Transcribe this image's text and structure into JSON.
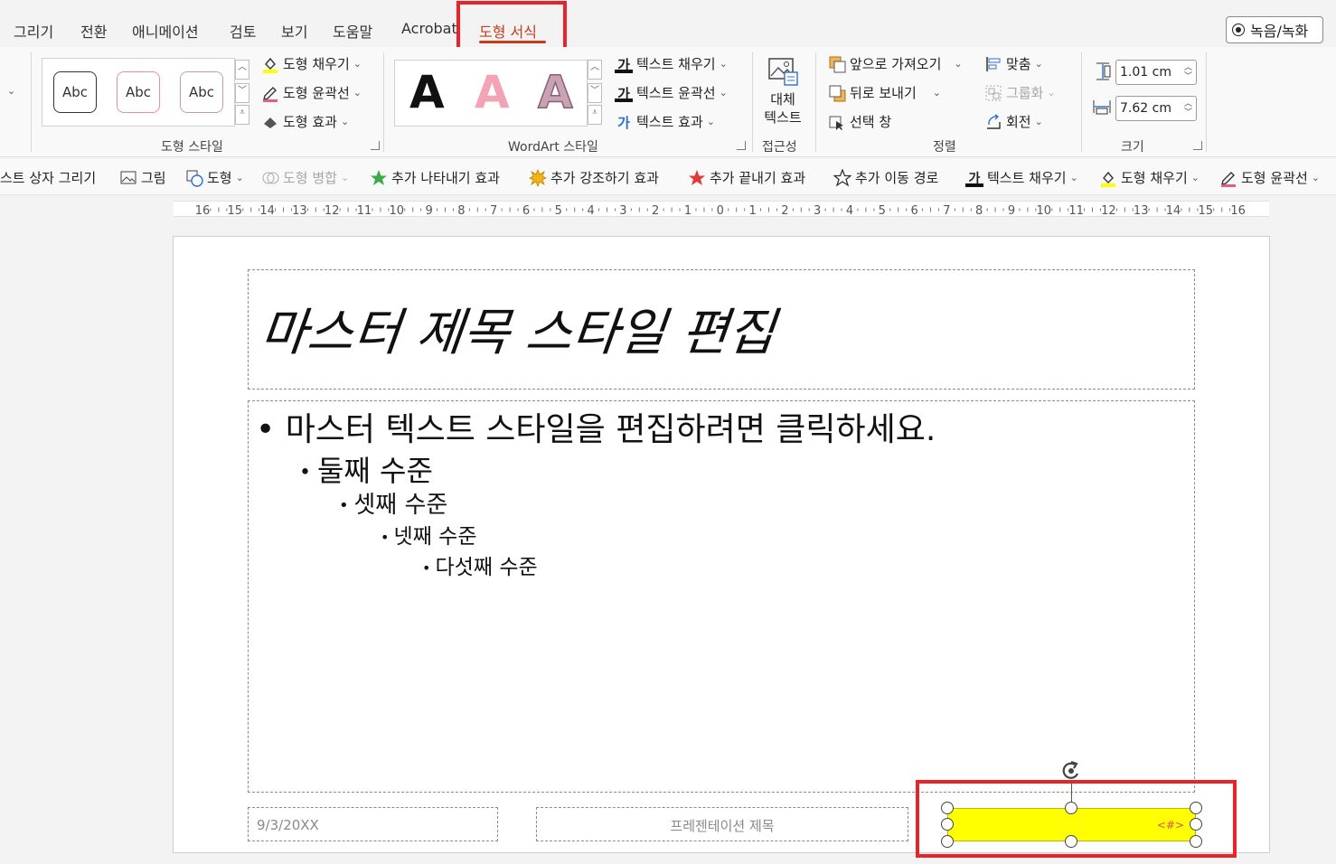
{
  "tabs": [
    {
      "label": "그리기"
    },
    {
      "label": "전환"
    },
    {
      "label": "애니메이션"
    },
    {
      "label": "검토"
    },
    {
      "label": "보기"
    },
    {
      "label": "도움말"
    },
    {
      "label": "Acrobat"
    },
    {
      "label": "도형 서식"
    }
  ],
  "record_button": "녹음/녹화",
  "ribbon": {
    "shape_styles": {
      "label": "도형 스타일",
      "abc": [
        "Abc",
        "Abc",
        "Abc"
      ],
      "fill": "도형 채우기",
      "outline": "도형 윤곽선",
      "effects": "도형 효과"
    },
    "wordart": {
      "label": "WordArt 스타일",
      "letters": [
        "A",
        "A",
        "A"
      ],
      "text_fill": "텍스트 채우기",
      "text_outline": "텍스트 윤곽선",
      "text_effects": "텍스트 효과"
    },
    "accessibility": {
      "label": "접근성",
      "alt_text_line1": "대체",
      "alt_text_line2": "텍스트"
    },
    "arrange": {
      "label": "정렬",
      "bring_forward": "앞으로 가져오기",
      "send_backward": "뒤로 보내기",
      "selection_pane": "선택 창",
      "align": "맞춤",
      "group": "그룹화",
      "rotate": "회전"
    },
    "size": {
      "label": "크기",
      "height": "1.01 cm",
      "width": "7.62 cm"
    }
  },
  "quick_toolbar": {
    "text_box": "스트 상자 그리기",
    "picture": "그림",
    "shapes": "도형",
    "merge_shapes": "도형 병합",
    "entrance": "추가 나타내기 효과",
    "emphasis": "추가 강조하기 효과",
    "exit": "추가 끝내기 효과",
    "motion": "추가 이동 경로",
    "text_fill": "텍스트 채우기",
    "shape_fill": "도형 채우기",
    "shape_outline": "도형 윤곽선"
  },
  "ruler": [
    "16",
    "15",
    "14",
    "13",
    "12",
    "11",
    "10",
    "9",
    "8",
    "7",
    "6",
    "5",
    "4",
    "3",
    "2",
    "1",
    "0",
    "1",
    "2",
    "3",
    "4",
    "5",
    "6",
    "7",
    "8",
    "9",
    "10",
    "11",
    "12",
    "13",
    "14",
    "15",
    "16"
  ],
  "slide": {
    "title": "마스터 제목 스타일 편집",
    "bullets": [
      {
        "text": "마스터 텍스트 스타일을 편집하려면 클릭하세요."
      },
      {
        "text": "둘째 수준"
      },
      {
        "text": "셋째 수준"
      },
      {
        "text": "넷째 수준"
      },
      {
        "text": "다섯째 수준"
      }
    ],
    "date": "9/3/20XX",
    "footer": "프레젠테이션 제목",
    "slide_number": "<#>"
  },
  "colors": {
    "accent": "#c43e1c",
    "highlight_box": "#e8232a",
    "selected_shape_fill": "#ffff00"
  }
}
